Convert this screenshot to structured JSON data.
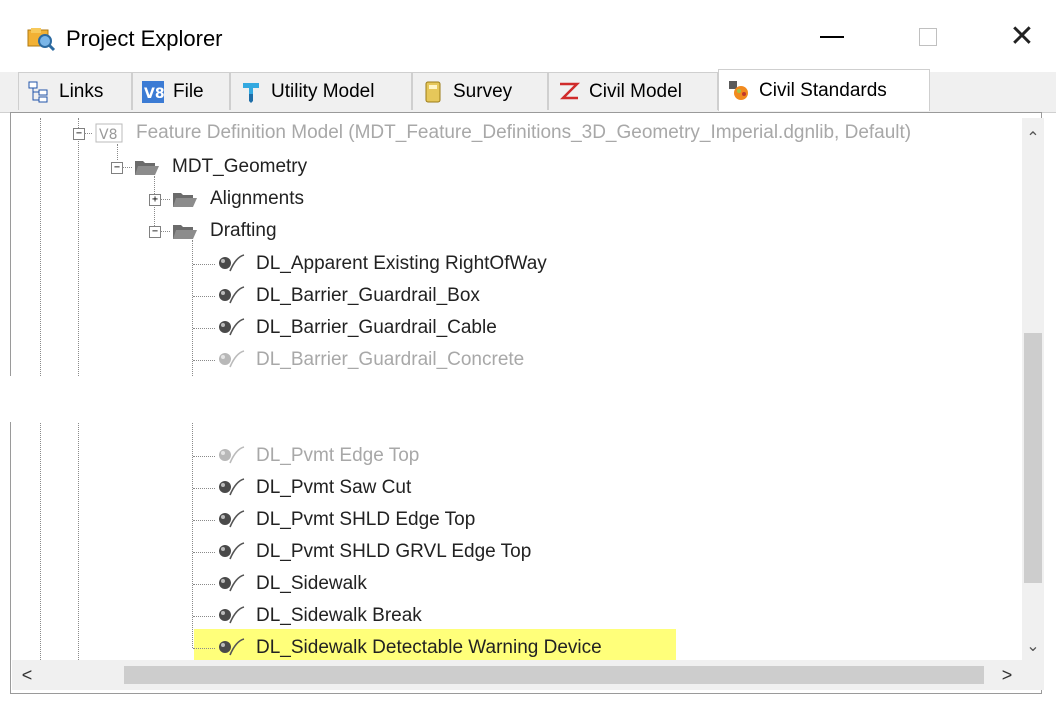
{
  "window": {
    "title": "Project Explorer",
    "minimize_glyph": "—",
    "close_glyph": "✕",
    "app_icon": "project-explorer-icon"
  },
  "tabs": [
    {
      "label": "Links",
      "icon": "links-icon",
      "active": false
    },
    {
      "label": "File",
      "icon": "v8-file-icon",
      "active": false
    },
    {
      "label": "Utility Model",
      "icon": "utility-model-icon",
      "active": false
    },
    {
      "label": "Survey",
      "icon": "survey-icon",
      "active": false
    },
    {
      "label": "Civil Model",
      "icon": "civil-model-icon",
      "active": false
    },
    {
      "label": "Civil Standards",
      "icon": "civil-standards-icon",
      "active": true
    }
  ],
  "tree": {
    "root": {
      "label": "Feature Definition Model (MDT_Feature_Definitions_3D_Geometry_Imperial.dgnlib, Default)",
      "expanded": true
    },
    "folder": {
      "label": "MDT_Geometry",
      "expanded": true
    },
    "subfolders": [
      {
        "label": "Alignments",
        "expanded": false
      },
      {
        "label": "Drafting",
        "expanded": true
      }
    ],
    "items_top": [
      {
        "label": "DL_Apparent Existing RightOfWay",
        "faded": false
      },
      {
        "label": "DL_Barrier_Guardrail_Box",
        "faded": false
      },
      {
        "label": "DL_Barrier_Guardrail_Cable",
        "faded": false
      },
      {
        "label": "DL_Barrier_Guardrail_Concrete",
        "faded": true
      }
    ],
    "items_bottom": [
      {
        "label": "DL_Pvmt Edge Top",
        "faded": true
      },
      {
        "label": "DL_Pvmt Saw Cut",
        "faded": false
      },
      {
        "label": "DL_Pvmt SHLD Edge Top",
        "faded": false
      },
      {
        "label": "DL_Pvmt SHLD GRVL Edge Top",
        "faded": false
      },
      {
        "label": "DL_Sidewalk",
        "faded": false
      },
      {
        "label": "DL_Sidewalk Break",
        "faded": false
      },
      {
        "label": "DL_Sidewalk Detectable Warning Device",
        "faded": false,
        "highlighted": true
      }
    ]
  },
  "scroll": {
    "up": "⌃",
    "down": "⌄",
    "left": "<",
    "right": ">"
  },
  "colors": {
    "highlight": "#ffff7a",
    "faded_text": "#a8a8a8"
  }
}
